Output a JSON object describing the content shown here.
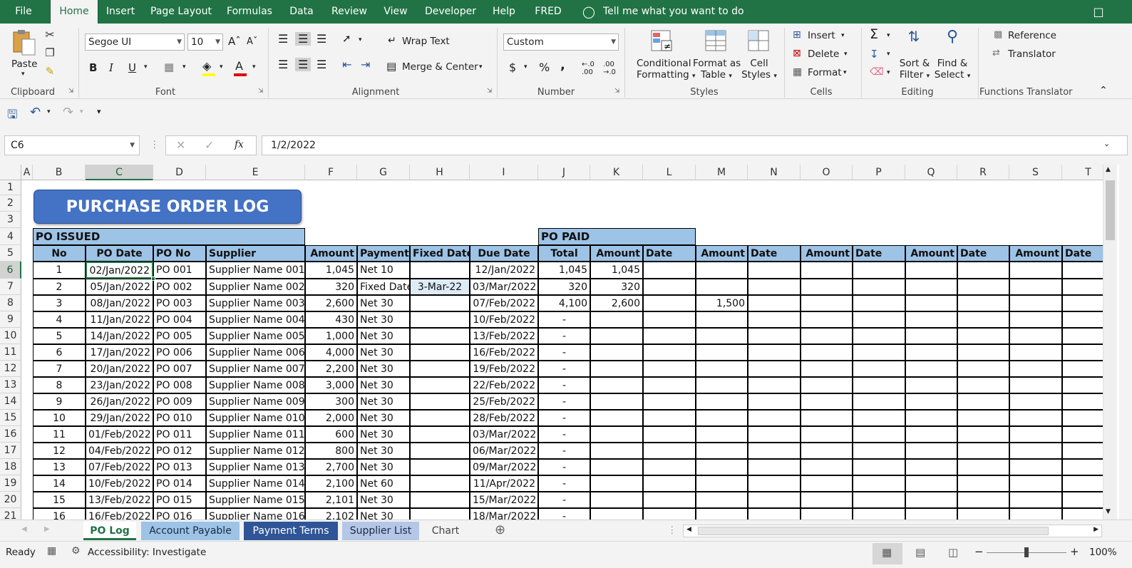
{
  "tabs": {
    "file": "File",
    "home": "Home",
    "insert": "Insert",
    "page_layout": "Page Layout",
    "formulas": "Formulas",
    "data": "Data",
    "review": "Review",
    "view": "View",
    "developer": "Developer",
    "help": "Help",
    "fred": "FRED",
    "tell": "Tell me what you want to do"
  },
  "ribbon": {
    "clipboard": {
      "paste": "Paste",
      "label": "Clipboard"
    },
    "font": {
      "name": "Segoe UI",
      "size": "10",
      "label": "Font",
      "bold": "B",
      "italic": "I",
      "underline": "U"
    },
    "alignment": {
      "wrap": "Wrap Text",
      "merge": "Merge & Center",
      "label": "Alignment"
    },
    "number": {
      "format": "Custom",
      "label": "Number",
      "currency": "$",
      "percent": "%",
      "comma": ","
    },
    "styles": {
      "conditional1": "Conditional",
      "conditional2": "Formatting",
      "format_as1": "Format as",
      "format_as2": "Table",
      "cell1": "Cell",
      "cell2": "Styles",
      "label": "Styles"
    },
    "cells": {
      "insert": "Insert",
      "delete": "Delete",
      "format": "Format",
      "label": "Cells"
    },
    "editing": {
      "sort1": "Sort &",
      "sort2": "Filter",
      "find1": "Find &",
      "find2": "Select",
      "label": "Editing"
    },
    "translator": {
      "reference": "Reference",
      "translator": "Translator",
      "label": "Functions Translator"
    }
  },
  "formula_bar": {
    "cell_ref": "C6",
    "formula": "1/2/2022",
    "fx": "fx"
  },
  "columns": [
    "A",
    "B",
    "C",
    "D",
    "E",
    "F",
    "G",
    "H",
    "I",
    "J",
    "K",
    "L",
    "M",
    "N",
    "O",
    "P",
    "Q",
    "R",
    "S",
    "T"
  ],
  "rows": [
    "1",
    "2",
    "3",
    "4",
    "5",
    "6",
    "7",
    "8",
    "9",
    "10",
    "11",
    "12",
    "13",
    "14",
    "15",
    "16",
    "17",
    "18",
    "19",
    "20",
    "21"
  ],
  "sheet": {
    "title": "PURCHASE ORDER LOG",
    "po_issued": "PO ISSUED",
    "po_paid": "PO PAID",
    "headers_issued": [
      "No",
      "PO Date",
      "PO No",
      "Supplier",
      "Amount",
      "Payment T",
      "Fixed Date",
      "Due Date"
    ],
    "headers_paid": [
      "Total",
      "Amount",
      "Date",
      "Amount",
      "Date",
      "Amount",
      "Date",
      "Amount",
      "Date",
      "Amount",
      "Date"
    ],
    "data": [
      [
        "1",
        "02/Jan/2022",
        "PO 001",
        "Supplier Name 001",
        "1,045",
        "Net 10",
        "",
        "12/Jan/2022",
        "1,045",
        "1,045",
        "",
        ""
      ],
      [
        "2",
        "05/Jan/2022",
        "PO 002",
        "Supplier Name 002",
        "320",
        "Fixed Date",
        "3-Mar-22",
        "03/Mar/2022",
        "320",
        "320",
        "",
        ""
      ],
      [
        "3",
        "08/Jan/2022",
        "PO 003",
        "Supplier Name 003",
        "2,600",
        "Net 30",
        "",
        "07/Feb/2022",
        "4,100",
        "2,600",
        "",
        "1,500"
      ],
      [
        "4",
        "11/Jan/2022",
        "PO 004",
        "Supplier Name 004",
        "430",
        "Net 30",
        "",
        "10/Feb/2022",
        "-",
        "",
        "",
        ""
      ],
      [
        "5",
        "14/Jan/2022",
        "PO 005",
        "Supplier Name 005",
        "1,000",
        "Net 30",
        "",
        "13/Feb/2022",
        "-",
        "",
        "",
        ""
      ],
      [
        "6",
        "17/Jan/2022",
        "PO 006",
        "Supplier Name 006",
        "4,000",
        "Net 30",
        "",
        "16/Feb/2022",
        "-",
        "",
        "",
        ""
      ],
      [
        "7",
        "20/Jan/2022",
        "PO 007",
        "Supplier Name 007",
        "2,200",
        "Net 30",
        "",
        "19/Feb/2022",
        "-",
        "",
        "",
        ""
      ],
      [
        "8",
        "23/Jan/2022",
        "PO 008",
        "Supplier Name 008",
        "3,000",
        "Net 30",
        "",
        "22/Feb/2022",
        "-",
        "",
        "",
        ""
      ],
      [
        "9",
        "26/Jan/2022",
        "PO 009",
        "Supplier Name 009",
        "300",
        "Net 30",
        "",
        "25/Feb/2022",
        "-",
        "",
        "",
        ""
      ],
      [
        "10",
        "29/Jan/2022",
        "PO 010",
        "Supplier Name 010",
        "2,000",
        "Net 30",
        "",
        "28/Feb/2022",
        "-",
        "",
        "",
        ""
      ],
      [
        "11",
        "01/Feb/2022",
        "PO 011",
        "Supplier Name 011",
        "600",
        "Net 30",
        "",
        "03/Mar/2022",
        "-",
        "",
        "",
        ""
      ],
      [
        "12",
        "04/Feb/2022",
        "PO 012",
        "Supplier Name 012",
        "800",
        "Net 30",
        "",
        "06/Mar/2022",
        "-",
        "",
        "",
        ""
      ],
      [
        "13",
        "07/Feb/2022",
        "PO 013",
        "Supplier Name 013",
        "2,700",
        "Net 30",
        "",
        "09/Mar/2022",
        "-",
        "",
        "",
        ""
      ],
      [
        "14",
        "10/Feb/2022",
        "PO 014",
        "Supplier Name 014",
        "2,100",
        "Net 60",
        "",
        "11/Apr/2022",
        "-",
        "",
        "",
        ""
      ],
      [
        "15",
        "13/Feb/2022",
        "PO 015",
        "Supplier Name 015",
        "2,101",
        "Net 30",
        "",
        "15/Mar/2022",
        "-",
        "",
        "",
        ""
      ],
      [
        "16",
        "16/Feb/2022",
        "PO 016",
        "Supplier Name 016",
        "2,102",
        "Net 30",
        "",
        "18/Mar/2022",
        "-",
        "",
        "",
        ""
      ]
    ]
  },
  "sheet_tabs": [
    "PO Log",
    "Account Payable",
    "Payment Terms",
    "Supplier List",
    "Chart"
  ],
  "status": {
    "ready": "Ready",
    "accessibility": "Accessibility: Investigate",
    "zoom": "100%"
  },
  "colors": {
    "accent": "#217346",
    "header_fill": "#9dc3e6",
    "title_fill": "#4472c4"
  }
}
